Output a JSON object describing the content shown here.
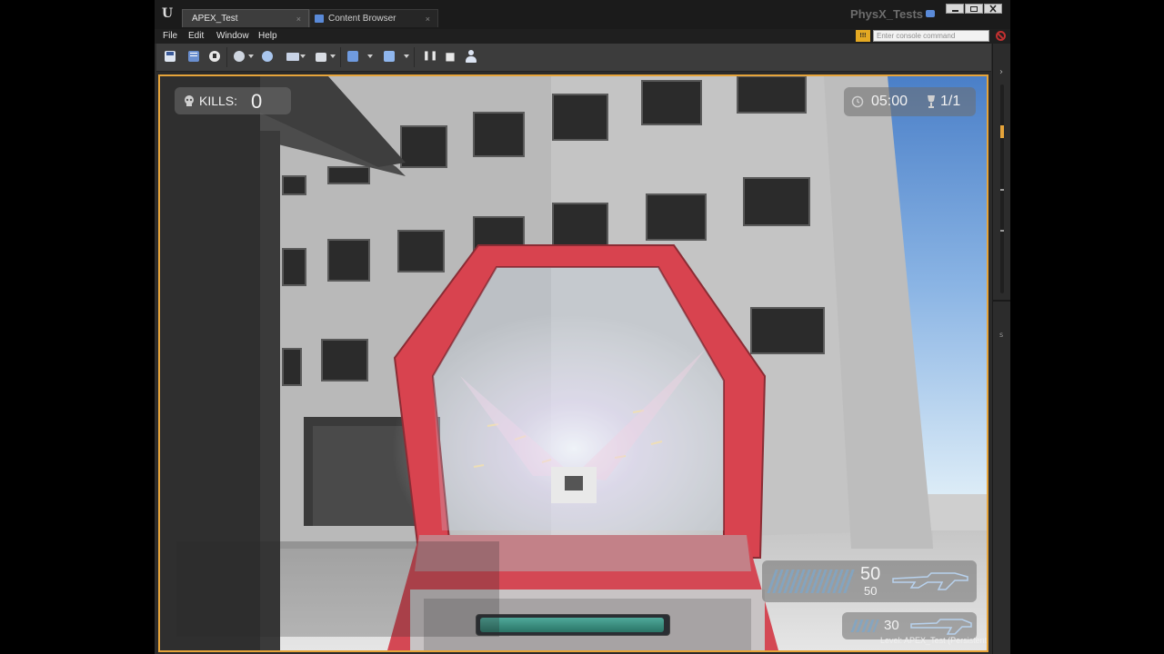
{
  "app": {
    "tabs": [
      {
        "label": "APEX_Test",
        "close": "×"
      },
      {
        "label": "Content Browser",
        "close": "×"
      }
    ],
    "project_title": "PhysX_Tests",
    "logo_glyph": "U"
  },
  "menu": {
    "items": [
      "File",
      "Edit",
      "Window",
      "Help"
    ],
    "console_hint": "!!!",
    "console_placeholder": "Enter console command"
  },
  "toolbar": {
    "icons": [
      "save-icon",
      "content-icon",
      "marketplace-icon",
      "settings-icon",
      "world-icon",
      "blueprints-icon",
      "matinee-icon",
      "build-icon",
      "launch-icon",
      "pause-icon",
      "stop-icon",
      "possess-icon"
    ],
    "pause_glyph": "❚❚",
    "stop_glyph": "■",
    "accent": "#e6a43a"
  },
  "hud": {
    "kills_label": "KILLS:",
    "kills_value": "0",
    "timer": "05:00",
    "round": "1/1",
    "ammo_clip": "50",
    "ammo_reserve": "50",
    "grenades": "30",
    "weapon_color": "#e0454f",
    "health_fraction": 1.0
  },
  "status": {
    "level_prefix": "Level:",
    "level_name": "APEX_Test (Persistent)"
  }
}
